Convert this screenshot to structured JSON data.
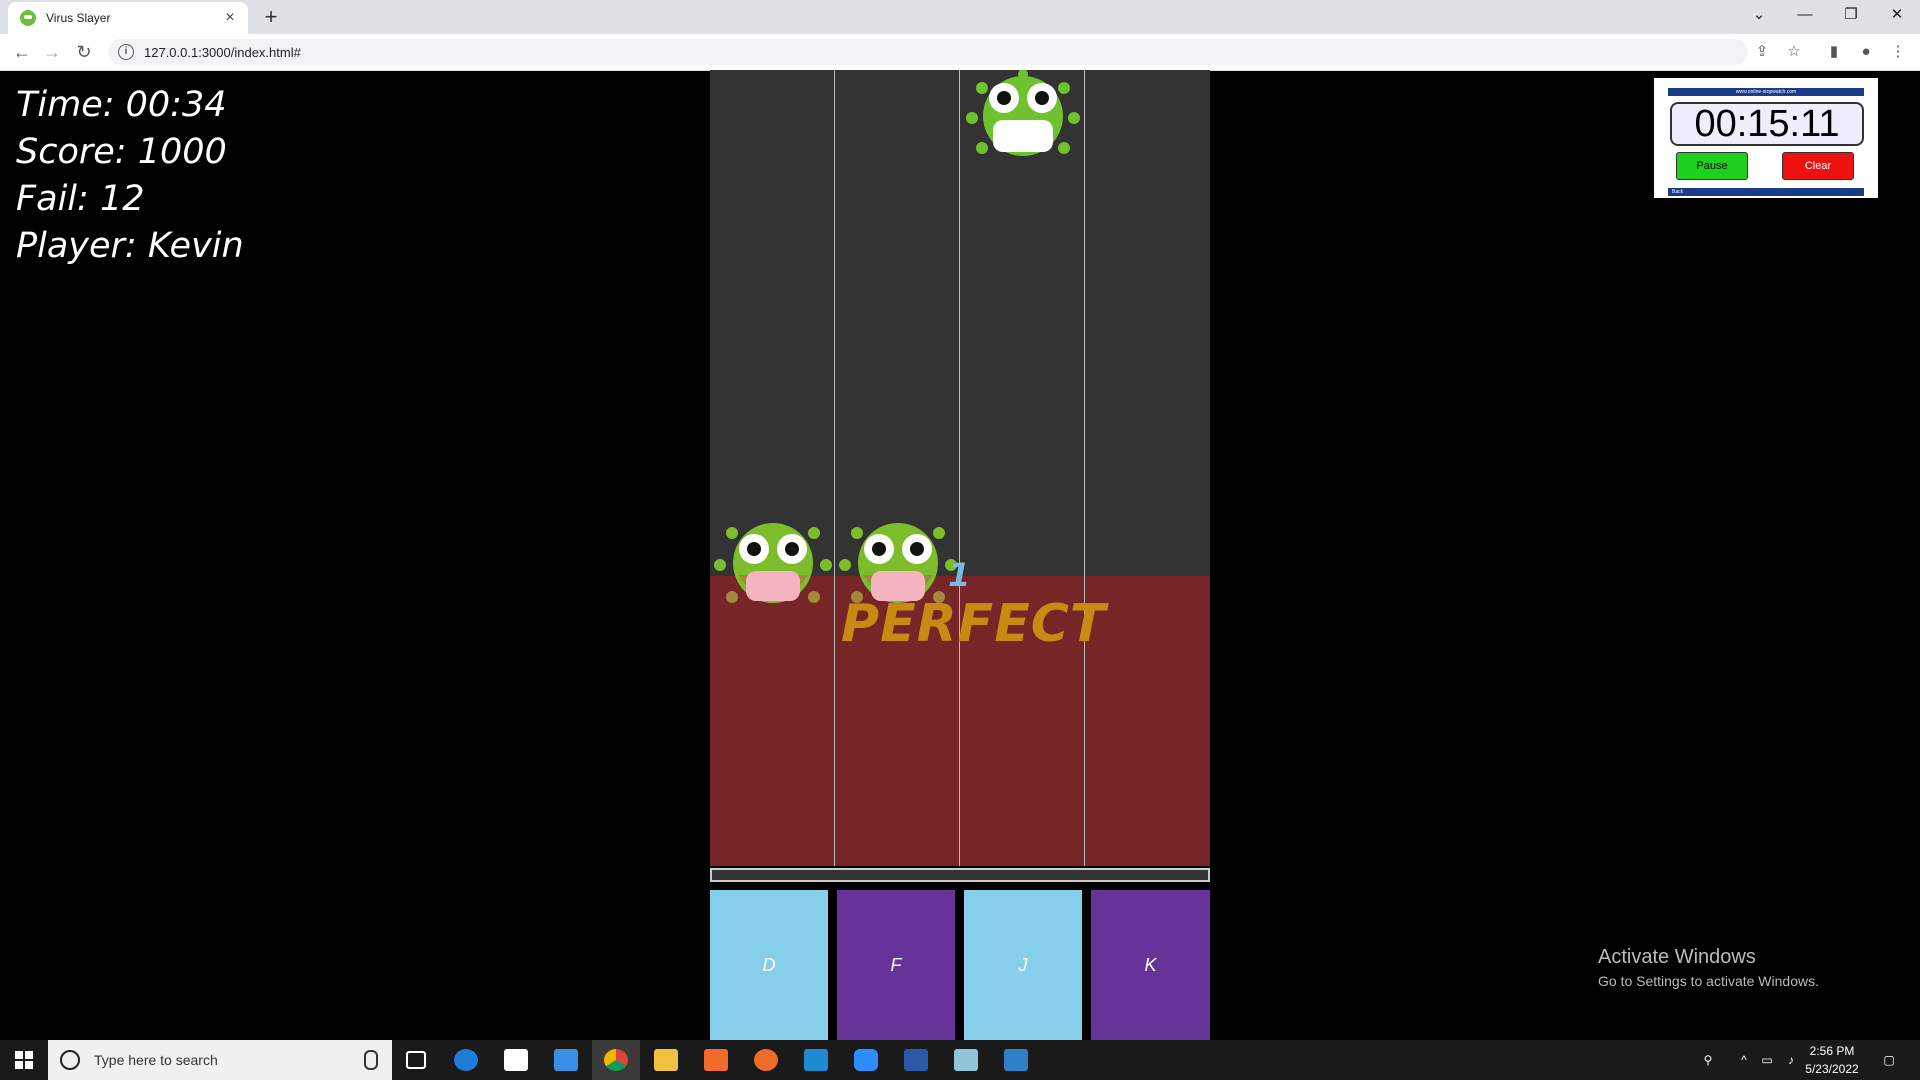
{
  "browser": {
    "tab_title": "Virus Slayer",
    "tab_close": "×",
    "new_tab": "+",
    "url": "127.0.0.1:3000/index.html#",
    "window_controls": {
      "dropdown": "⌄",
      "minimize": "—",
      "restore": "❐",
      "close": "✕"
    }
  },
  "hud": {
    "time": "Time: 00:34",
    "score": "Score: 1000",
    "fail": "Fail: 12",
    "player": "Player: Kevin"
  },
  "game": {
    "judgement": "PERFECT",
    "combo": "1",
    "keys": [
      {
        "label": "D",
        "color": "#87ceeb"
      },
      {
        "label": "F",
        "color": "#663399"
      },
      {
        "label": "J",
        "color": "#87ceeb"
      },
      {
        "label": "K",
        "color": "#663399"
      }
    ],
    "colors": {
      "lane_bg": "#333333",
      "hit_zone": "#772628",
      "perfect": "#c98a12"
    }
  },
  "stopwatch": {
    "site": "www.online-stopwatch.com",
    "time": "00:15:11",
    "pause": "Pause",
    "clear": "Clear",
    "back": "Back"
  },
  "watermark": {
    "title": "Activate Windows",
    "subtitle": "Go to Settings to activate Windows."
  },
  "taskbar": {
    "search_placeholder": "Type here to search",
    "time": "2:56 PM",
    "date": "5/23/2022"
  }
}
